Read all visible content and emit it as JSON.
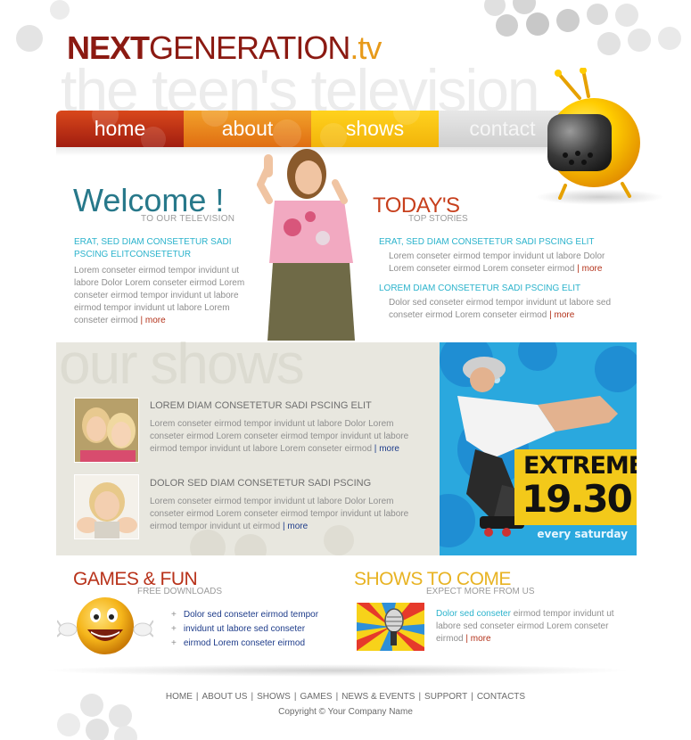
{
  "site": {
    "logo_next": "NEXT",
    "logo_generation": "GENERATION",
    "logo_tv": ".tv",
    "tagline": "the teen's television"
  },
  "nav": {
    "items": [
      {
        "label": "home"
      },
      {
        "label": "about"
      },
      {
        "label": "shows"
      },
      {
        "label": "contact"
      }
    ]
  },
  "welcome": {
    "title": "Welcome !",
    "subtitle": "TO OUR TELEVISION",
    "heading": "ERAT, SED DIAM CONSETETUR SADI PSCING ELITCONSETETUR",
    "body": "Lorem conseter eirmod tempor invidunt ut labore Dolor Lorem conseter eirmod Lorem conseter eirmod tempor invidunt ut labore eirmod tempor invidunt ut labore Lorem conseter eirmod",
    "more": "more"
  },
  "today": {
    "title": "TODAY'S",
    "subtitle": "TOP STORIES",
    "stories": [
      {
        "heading": "ERAT, SED DIAM CONSETETUR SADI PSCING ELIT",
        "body": "Lorem conseter eirmod tempor invidunt ut labore Dolor Lorem conseter eirmod Lorem conseter eirmod",
        "more": "more"
      },
      {
        "heading": "LOREM  DIAM CONSETETUR SADI PSCING ELIT",
        "body": "Dolor sed conseter eirmod tempor invidunt ut labore sed conseter eirmod Lorem conseter eirmod",
        "more": "more"
      }
    ]
  },
  "shows": {
    "title": "our shows",
    "items": [
      {
        "heading": "LOREM  DIAM CONSETETUR SADI PSCING ELIT",
        "body": "Lorem conseter eirmod tempor invidunt ut labore Dolor Lorem conseter eirmod Lorem conseter eirmod tempor invidunt ut labore eirmod tempor invidunt ut labore Lorem conseter eirmod",
        "more": "more"
      },
      {
        "heading": "DOLOR SED DIAM CONSETETUR SADI PSCING",
        "body": "Lorem conseter eirmod tempor invidunt ut labore Dolor Lorem conseter eirmod Lorem conseter eirmod tempor invidunt ut labore eirmod tempor invidunt ut eirmod",
        "more": "more"
      }
    ]
  },
  "promo": {
    "title": "EXTREME",
    "time": "19.30",
    "schedule": "every saturday"
  },
  "games": {
    "title": "GAMES & FUN",
    "subtitle": "FREE DOWNLOADS",
    "links": [
      "Dolor sed conseter eirmod tempor",
      "invidunt ut labore sed conseter",
      "eirmod Lorem conseter eirmod"
    ]
  },
  "shows_to_come": {
    "title": "SHOWS TO COME",
    "subtitle": "EXPECT MORE FROM US",
    "link_text": "Dolor sed conseter",
    "body": " eirmod tempor invidunt ut labore sed conseter eirmod Lorem conseter eirmod",
    "more": "more"
  },
  "footer": {
    "links": [
      "HOME",
      "ABOUT US",
      "SHOWS",
      "GAMES",
      "NEWS & EVENTS",
      "SUPPORT",
      "CONTACTS"
    ],
    "copyright": "Copyright © Your Company Name"
  },
  "colors": {
    "brand_red": "#8b1a12",
    "accent_orange": "#e79a1a",
    "accent_teal": "#27788a",
    "link_cyan": "#2bb3cc",
    "more_red": "#b3321a",
    "promo_blue": "#29a9df",
    "promo_yellow": "#f3c91a"
  },
  "icons": {
    "tv": "retro-tv-icon",
    "smiley": "smiley-face-icon",
    "microphone": "microphone-icon"
  }
}
